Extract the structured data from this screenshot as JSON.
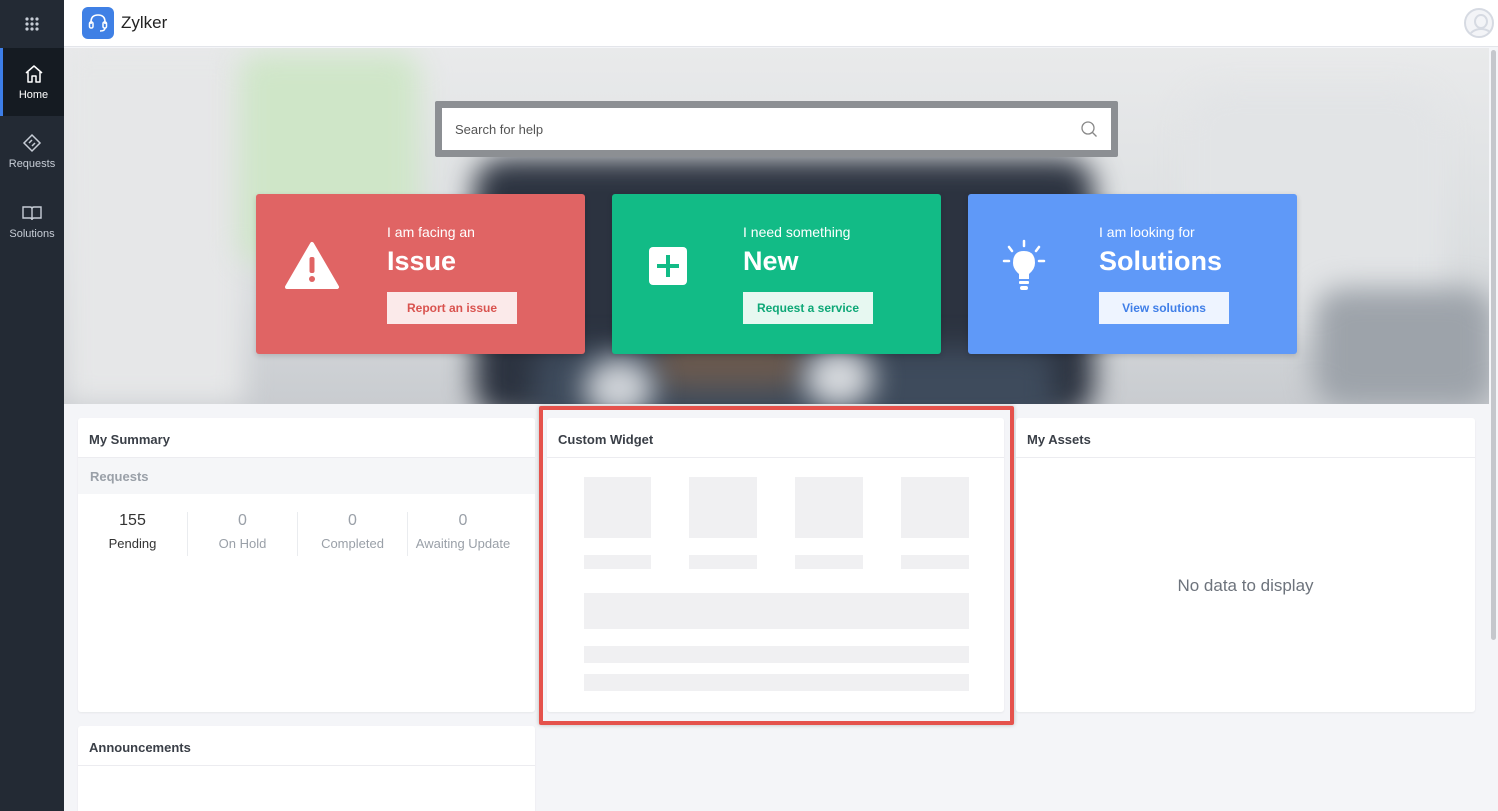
{
  "app": {
    "name": "Zylker"
  },
  "nav": {
    "items": [
      {
        "label": "Home",
        "icon": "home-icon",
        "active": true
      },
      {
        "label": "Requests",
        "icon": "ticket-icon",
        "active": false
      },
      {
        "label": "Solutions",
        "icon": "book-icon",
        "active": false
      }
    ]
  },
  "search": {
    "placeholder": "Search for help",
    "value": ""
  },
  "cards": [
    {
      "subtitle": "I am facing an",
      "title": "Issue",
      "button": "Report an issue",
      "icon": "warning-icon",
      "color": "#e06464"
    },
    {
      "subtitle": "I need something",
      "title": "New",
      "button": "Request a service",
      "icon": "plus-icon",
      "color": "#12bb86"
    },
    {
      "subtitle": "I am looking for",
      "title": "Solutions",
      "button": "View solutions",
      "icon": "lightbulb-icon",
      "color": "#5f99f8"
    }
  ],
  "summary": {
    "title": "My Summary",
    "section": "Requests",
    "stats": [
      {
        "value": "155",
        "label": "Pending"
      },
      {
        "value": "0",
        "label": "On Hold"
      },
      {
        "value": "0",
        "label": "Completed"
      },
      {
        "value": "0",
        "label": "Awaiting Update"
      }
    ]
  },
  "widget": {
    "title": "Custom Widget",
    "highlight_color": "#e5524c"
  },
  "assets": {
    "title": "My Assets",
    "empty_text": "No data to display"
  },
  "announcements": {
    "title": "Announcements"
  }
}
